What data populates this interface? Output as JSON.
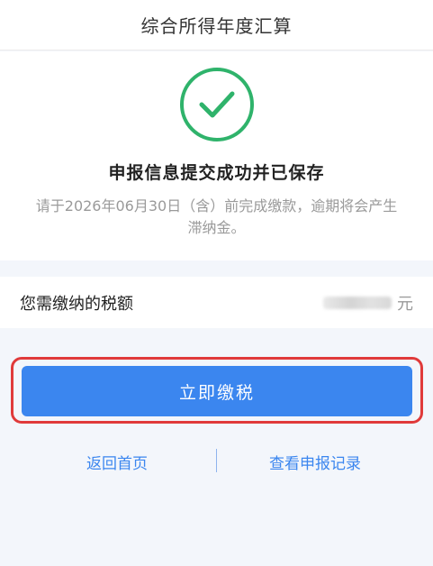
{
  "header": {
    "title": "综合所得年度汇算"
  },
  "status": {
    "icon": "check-circle-icon",
    "title": "申报信息提交成功并已保存",
    "note": "请于2026年06月30日（含）前完成缴款，逾期将会产生滞纳金。"
  },
  "tax": {
    "label": "您需缴纳的税额",
    "unit": "元"
  },
  "actions": {
    "pay_label": "立即缴税",
    "home_link": "返回首页",
    "records_link": "查看申报记录"
  },
  "colors": {
    "accent": "#3b86ef",
    "success": "#2fb36b",
    "highlight": "#e03a3a"
  }
}
